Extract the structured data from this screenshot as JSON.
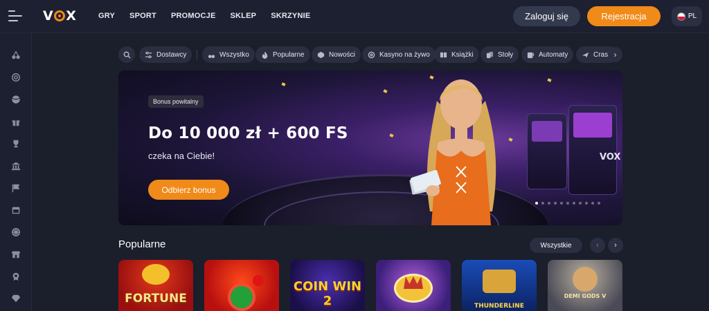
{
  "header": {
    "logo": "VOX",
    "nav": [
      "GRY",
      "SPORT",
      "PROMOCJE",
      "SKLEP",
      "SKRZYNIE"
    ],
    "login_label": "Zaloguj się",
    "register_label": "Rejestracja",
    "lang_code": "PL"
  },
  "sidebar": {
    "icons": [
      "cherries-icon",
      "target-icon",
      "ball-icon",
      "gift-icon",
      "trophy-icon",
      "bank-icon",
      "flag-icon",
      "calendar-icon",
      "wheel-icon",
      "shop-icon",
      "medal-icon",
      "diamond-icon"
    ]
  },
  "filters": {
    "search_icon": "search-icon",
    "providers_label": "Dostawcy",
    "items": [
      {
        "label": "Wszystko",
        "icon": "cherries-icon"
      },
      {
        "label": "Popularne",
        "icon": "flame-icon"
      },
      {
        "label": "Nowości",
        "icon": "cube-icon"
      },
      {
        "label": "Kasyno na żywo",
        "icon": "chip-icon"
      },
      {
        "label": "Książki",
        "icon": "book-icon"
      },
      {
        "label": "Stoły",
        "icon": "cards-icon"
      },
      {
        "label": "Automaty",
        "icon": "slot-icon"
      },
      {
        "label": "Crash",
        "icon": "plane-icon"
      }
    ]
  },
  "banner": {
    "badge": "Bonus powitalny",
    "headline": "Do 10 000 zł + 600 FS",
    "subline": "czeka na Ciebie!",
    "cta_label": "Odbierz bonus",
    "sign": "VOX",
    "slide_count": 11,
    "active_slide": 0
  },
  "popular": {
    "title": "Popularne",
    "all_label": "Wszystkie",
    "games": [
      {
        "name": "FORTUNE",
        "bg": "#c0191c"
      },
      {
        "name": "",
        "bg": "#d81a1a"
      },
      {
        "name": "COIN WIN 2",
        "bg": "#2a1a6a"
      },
      {
        "name": "",
        "bg": "#3b1f7a"
      },
      {
        "name": "THUNDERLINE",
        "bg": "#123a8a"
      },
      {
        "name": "DEMI GODS V",
        "bg": "#3a3a46"
      }
    ]
  }
}
